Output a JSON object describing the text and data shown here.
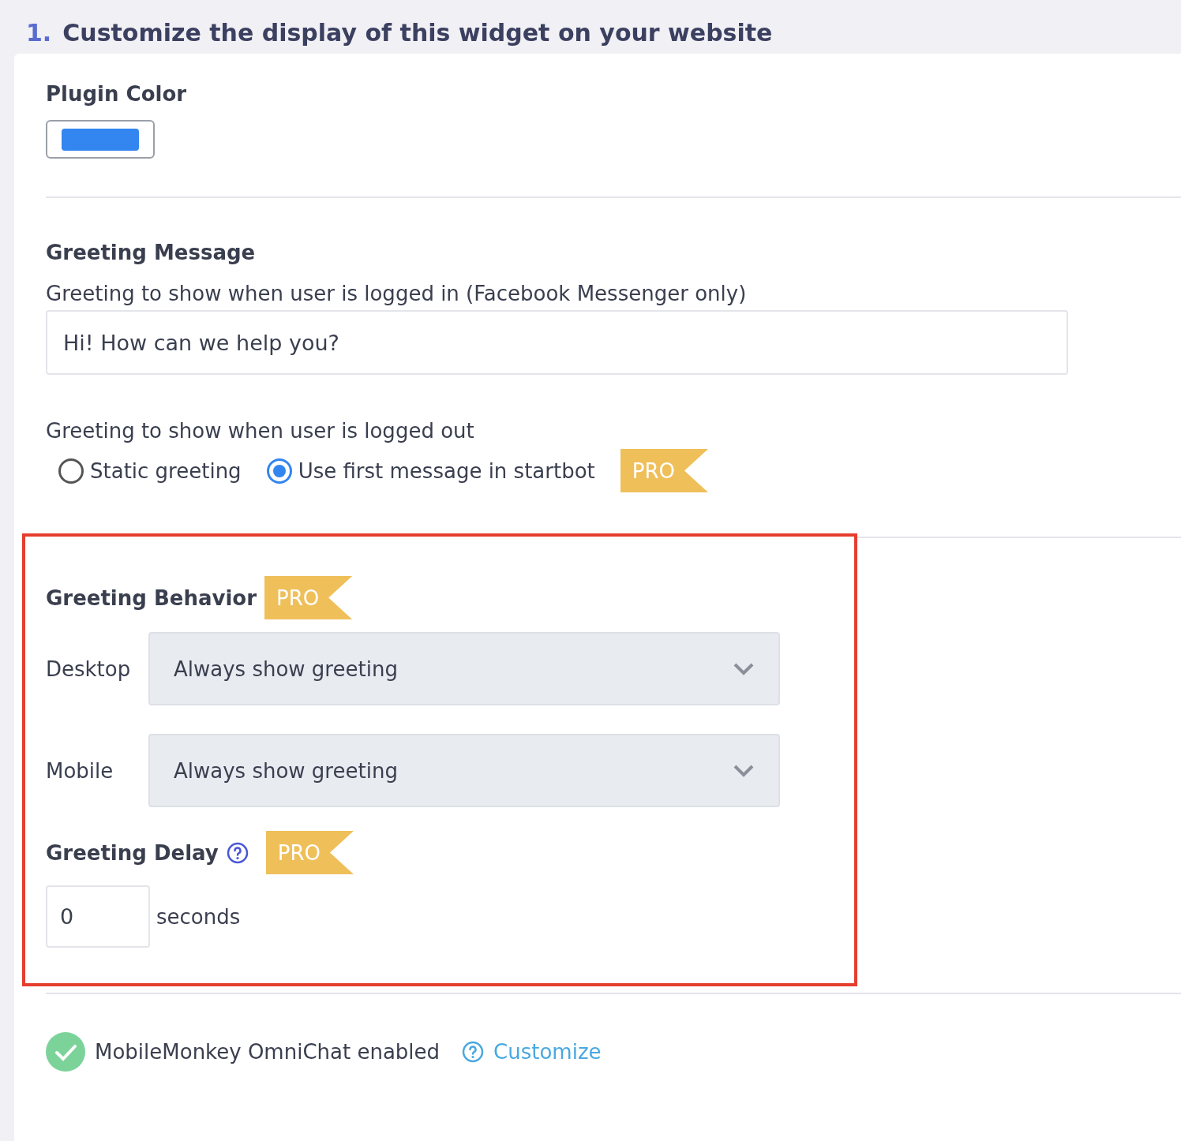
{
  "section": {
    "number": "1.",
    "title": "Customize the display of this widget on your website"
  },
  "plugin_color": {
    "label": "Plugin Color"
  },
  "greeting_message": {
    "heading": "Greeting Message",
    "logged_in_label": "Greeting to show when user is logged in (Facebook Messenger only)",
    "logged_in_value": "Hi! How can we help you?",
    "logged_out_label": "Greeting to show when user is logged out",
    "badge": "PRO",
    "options": [
      {
        "label": "Static greeting",
        "selected": false
      },
      {
        "label": "Use first message in startbot",
        "selected": true
      }
    ]
  },
  "greeting_behavior": {
    "heading": "Greeting Behavior",
    "badge": "PRO",
    "selects": [
      {
        "label": "Desktop",
        "value": "Always show greeting"
      },
      {
        "label": "Mobile",
        "value": "Always show greeting"
      }
    ]
  },
  "greeting_delay": {
    "heading": "Greeting Delay",
    "badge": "PRO",
    "value": "0",
    "unit": "seconds"
  },
  "omnichat": {
    "enabled": true,
    "text": "MobileMonkey OmniChat enabled",
    "link": "Customize"
  }
}
